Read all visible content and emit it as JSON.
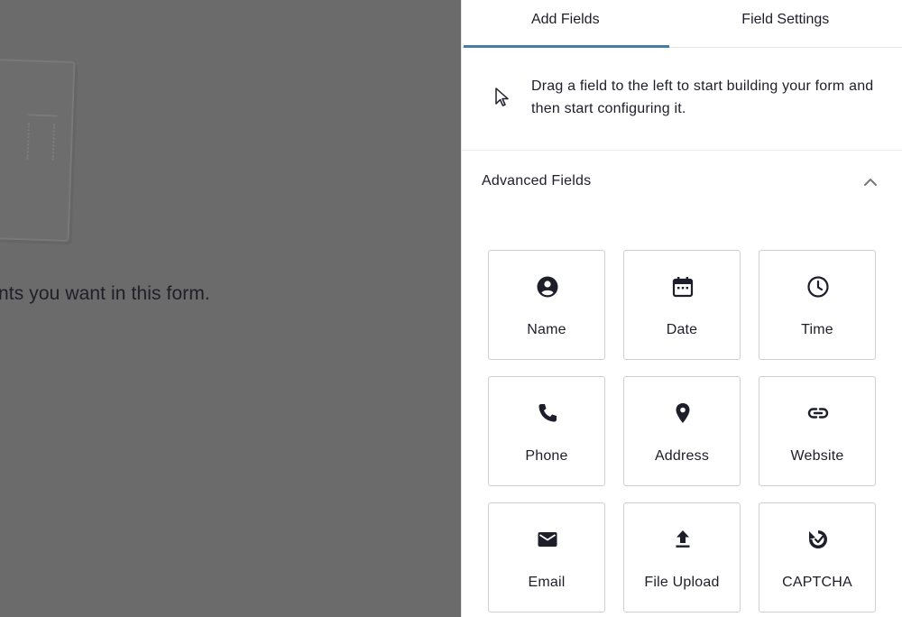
{
  "canvas": {
    "hint_text": "nts you want in this form."
  },
  "tabs": [
    {
      "label": "Add Fields"
    },
    {
      "label": "Field Settings"
    }
  ],
  "intro": {
    "text": "Drag a field to the left to start building your form and then start configuring it.",
    "icon": "cursor-arrow-icon"
  },
  "section": {
    "title": "Advanced Fields",
    "toggle_icon": "chevron-up-icon"
  },
  "fields": [
    {
      "label": "Name",
      "icon": "user-circle-icon"
    },
    {
      "label": "Date",
      "icon": "calendar-icon"
    },
    {
      "label": "Time",
      "icon": "clock-icon"
    },
    {
      "label": "Phone",
      "icon": "phone-icon"
    },
    {
      "label": "Address",
      "icon": "map-pin-icon"
    },
    {
      "label": "Website",
      "icon": "link-icon"
    },
    {
      "label": "Email",
      "icon": "envelope-icon"
    },
    {
      "label": "File Upload",
      "icon": "upload-icon"
    },
    {
      "label": "CAPTCHA",
      "icon": "captcha-icon"
    }
  ],
  "colors": {
    "accent": "#4a7da6",
    "overlay": "#6b6b6b",
    "icon": "#1e1e2a"
  }
}
